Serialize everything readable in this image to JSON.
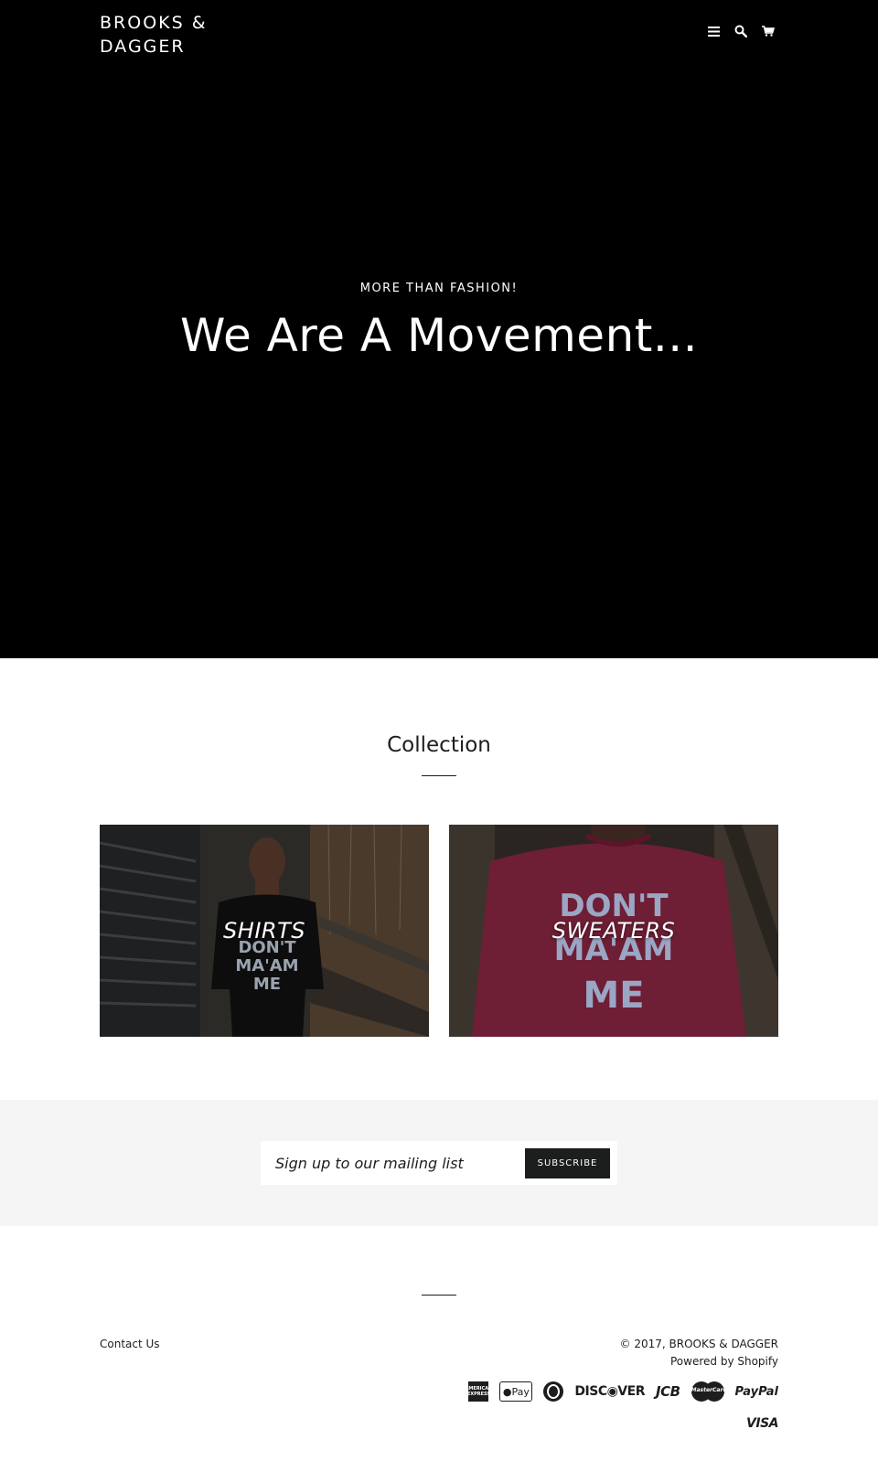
{
  "header": {
    "logo_line1": "BROOKS &",
    "logo_line2": "DAGGER",
    "icons": [
      "menu-icon",
      "search-icon",
      "cart-icon"
    ]
  },
  "hero": {
    "subtitle": "MORE THAN FASHION!",
    "title": "We Are A Movement..."
  },
  "collection": {
    "title": "Collection",
    "items": [
      {
        "label": "SHIRTS"
      },
      {
        "label": "SWEATERS"
      }
    ]
  },
  "newsletter": {
    "placeholder": "Sign up to our mailing list",
    "button_label": "SUBSCRIBE"
  },
  "footer": {
    "contact_label": "Contact Us",
    "copyright": "© 2017, BROOKS & DAGGER",
    "powered_by": "Powered by Shopify",
    "payment_methods": [
      "American Express",
      "Apple Pay",
      "Diners Club",
      "Discover",
      "JCB",
      "Master",
      "PayPal",
      "Visa"
    ],
    "apple_pay_text": "Pay",
    "discover_text": "DISC◉VER",
    "jcb_text": "JCB",
    "master_text": "MasterCard",
    "paypal_text": "PayPal",
    "visa_text": "VISA",
    "amex_text": "AMERICAN EXPRESS"
  },
  "colors": {
    "hero_bg": "#000000",
    "text": "#1c1d1d",
    "button_bg": "#1c1d1d",
    "newsletter_bg": "#f5f5f5"
  }
}
